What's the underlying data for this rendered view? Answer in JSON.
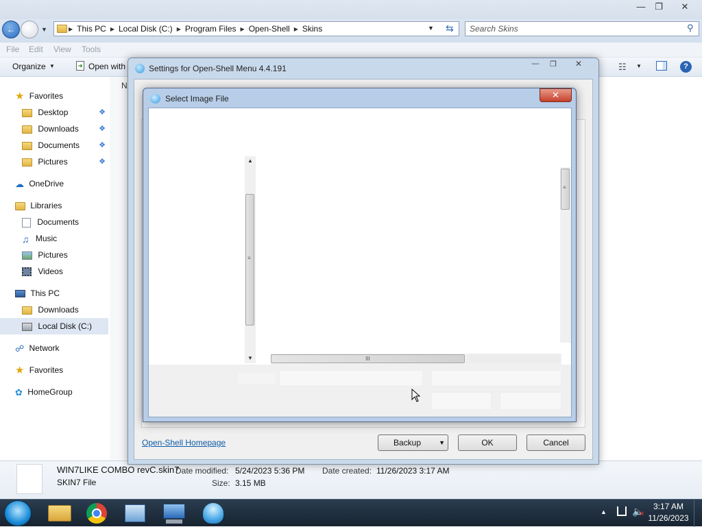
{
  "explorer": {
    "address": {
      "crumbs": [
        "This PC",
        "Local Disk (C:)",
        "Program Files",
        "Open-Shell",
        "Skins"
      ]
    },
    "search_placeholder": "Search Skins",
    "menu": [
      "File",
      "Edit",
      "View",
      "Tools"
    ],
    "commands": {
      "organize": "Organize",
      "open_with": "Open with"
    },
    "column_header_partial": "N",
    "nav": {
      "favorites": "Favorites",
      "desktop": "Desktop",
      "downloads": "Downloads",
      "documents": "Documents",
      "pictures": "Pictures",
      "onedrive": "OneDrive",
      "libraries": "Libraries",
      "lib_documents": "Documents",
      "lib_music": "Music",
      "lib_pictures": "Pictures",
      "lib_videos": "Videos",
      "this_pc": "This PC",
      "pc_downloads": "Downloads",
      "local_disk": "Local Disk (C:)",
      "network": "Network",
      "favorites2": "Favorites",
      "homegroup": "HomeGroup"
    },
    "details": {
      "file_name": "WIN7LIKE COMBO revC.skin7",
      "file_type": "SKIN7 File",
      "date_modified_label": "Date modified:",
      "date_modified": "5/24/2023 5:36 PM",
      "date_created_label": "Date created:",
      "date_created": "11/26/2023 3:17 AM",
      "size_label": "Size:",
      "size": "3.15 MB"
    }
  },
  "settings_dialog": {
    "title": "Settings for Open-Shell Menu 4.4.191",
    "homepage_link": "Open-Shell Homepage",
    "backup_label": "Backup",
    "ok_label": "OK",
    "cancel_label": "Cancel"
  },
  "image_dialog": {
    "title": "Select Image File",
    "hscroll_grip": "III",
    "close_symbol": "✕"
  },
  "taskbar": {
    "time": "3:17 AM",
    "date": "11/26/2023"
  }
}
